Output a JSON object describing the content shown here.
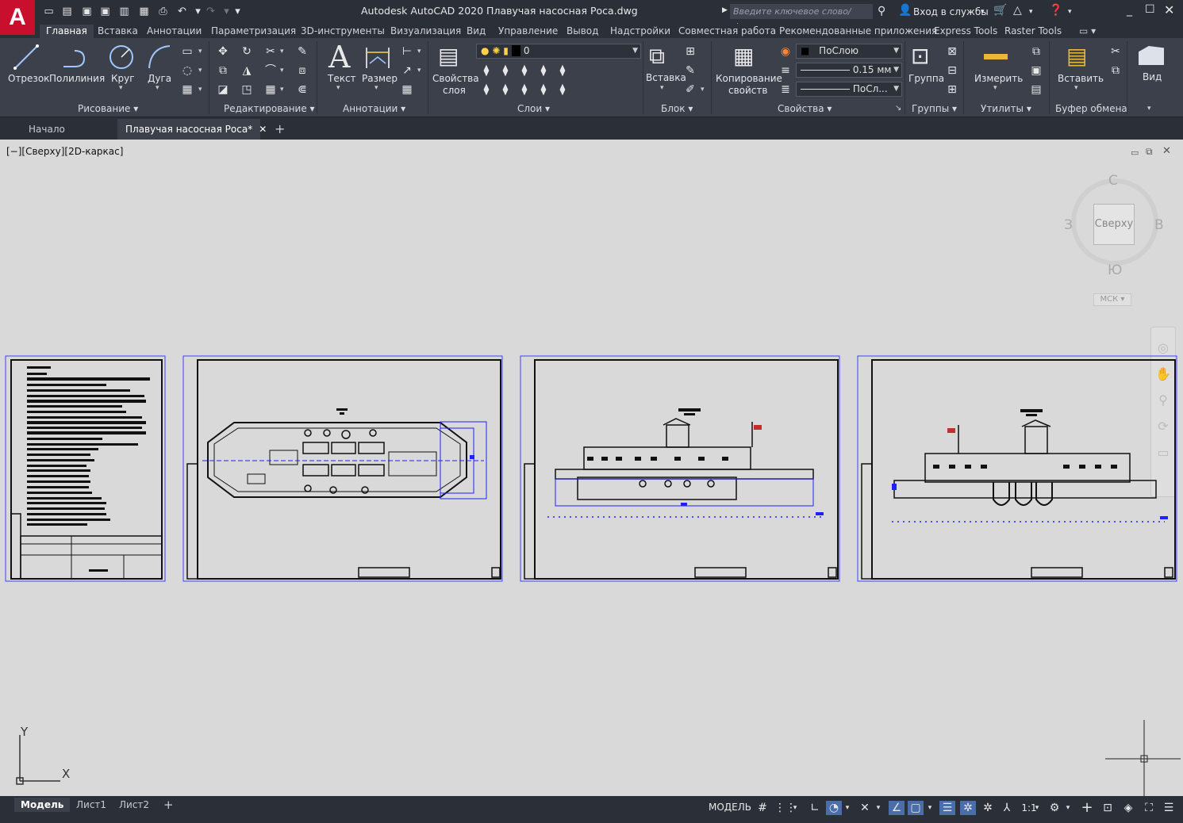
{
  "title_bar": {
    "logo": "A",
    "title": "Autodesk AutoCAD 2020    Плавучая насосная Роса.dwg",
    "search_placeholder": "Введите ключевое слово/фразу",
    "sign_in": "Вход в службы",
    "quick_access_icons": [
      "new-icon",
      "open-icon",
      "save-icon",
      "save-as-icon",
      "web-open-icon",
      "web-save-icon",
      "plot-icon",
      "undo-icon",
      "redo-icon",
      "customize-icon"
    ]
  },
  "ribbon_tabs": [
    "Главная",
    "Вставка",
    "Аннотации",
    "Параметризация",
    "3D-инструменты",
    "Визуализация",
    "Вид",
    "Управление",
    "Вывод",
    "Надстройки",
    "Совместная работа",
    "Рекомендованные приложения",
    "Express Tools",
    "Raster Tools"
  ],
  "ribbon": {
    "draw": {
      "title": "Рисование",
      "line": "Отрезок",
      "polyline": "Полилиния",
      "circle": "Круг",
      "arc": "Дуга"
    },
    "modify": {
      "title": "Редактирование"
    },
    "annotation": {
      "title": "Аннотации",
      "text": "Текст",
      "dimension": "Размер"
    },
    "layers": {
      "title": "Слои",
      "layer_props_1": "Свойства",
      "layer_props_2": "слоя",
      "current_layer": "0"
    },
    "block": {
      "title": "Блок",
      "insert": "Вставка"
    },
    "properties": {
      "title": "Свойства",
      "match_1": "Копирование",
      "match_2": "свойств",
      "color": "ПоСлою",
      "lineweight": "0.15 мм",
      "linetype": "ПоСл..."
    },
    "groups": {
      "title": "Группы",
      "group": "Группа"
    },
    "utilities": {
      "title": "Утилиты",
      "measure": "Измерить"
    },
    "clipboard": {
      "title": "Буфер обмена",
      "paste": "Вставить"
    },
    "view": {
      "title": "Вид"
    }
  },
  "file_tabs": [
    "Начало",
    "Плавучая насосная Роса*"
  ],
  "viewport": {
    "label": "[−][Сверху][2D-каркас]",
    "viewcube": {
      "face": "Сверху",
      "north": "С",
      "south": "Ю",
      "west": "З",
      "east": "В",
      "ucs": "МСК"
    },
    "ucs_x": "X",
    "ucs_y": "Y"
  },
  "status_bar": {
    "layout_tabs": [
      "Модель",
      "Лист1",
      "Лист2"
    ],
    "model": "МОДЕЛЬ",
    "scale": "1:1"
  }
}
